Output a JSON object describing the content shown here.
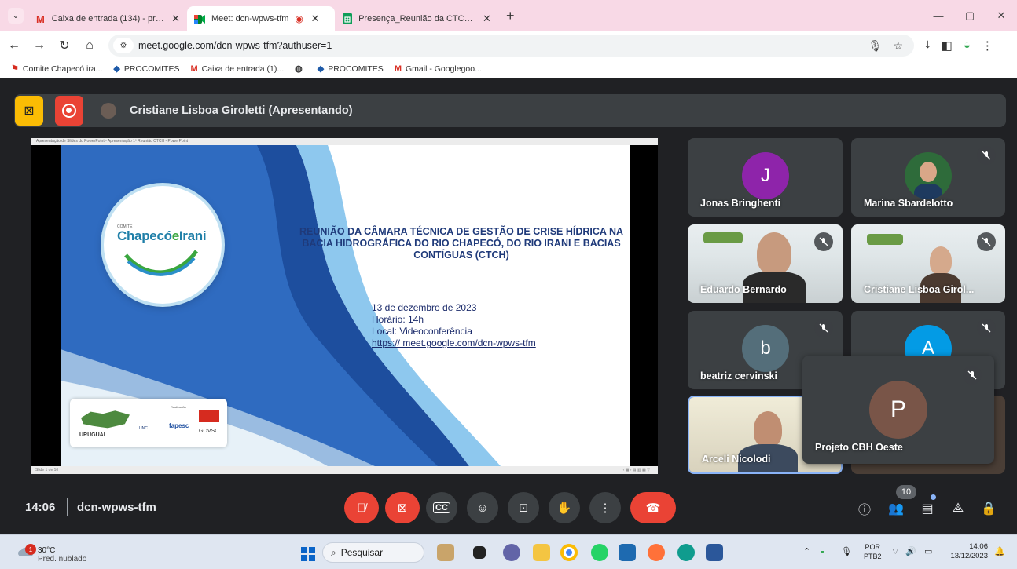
{
  "browser": {
    "tabs": [
      {
        "label": "Caixa de entrada (134) - projeto",
        "icon": "gmail-icon",
        "active": false
      },
      {
        "label": "Meet: dcn-wpws-tfm",
        "icon": "meet-icon",
        "active": true
      },
      {
        "label": "Presença_Reunião da CTCH do",
        "icon": "sheets-icon",
        "active": false
      }
    ],
    "url": "meet.google.com/dcn-wpws-tfm?authuser=1",
    "bookmarks": [
      "Comite Chapecó ira...",
      "PROCOMITES",
      "Caixa de entrada (1)...",
      "PROCOMITES",
      "Gmail - Googlegoo..."
    ]
  },
  "meet": {
    "presenter_title": "Cristiane Lisboa Giroletti (Apresentando)",
    "slide": {
      "window_title": "Apresentação de Slides do PowerPoint - Apresentação 1ª Reunião CTCH - PowerPoint",
      "meet_label": "meet.google.com/dcn-wpws-tfm",
      "logo_small": "COMITÊ",
      "logo_main_a": "Chapecó",
      "logo_main_b": "e",
      "logo_main_c": "Irani",
      "title": "REUNIÃO DA CÂMARA TÉCNICA DE GESTÃO DE CRISE HÍDRICA NA BACIA HIDROGRÁFICA DO RIO CHAPECÓ, DO RIO IRANI E BACIAS CONTÍGUAS (CTCH)",
      "date": "13 de dezembro de 2023",
      "time": "Horário: 14h",
      "place": "Local: Videoconferência",
      "link": "https:// meet.google.com/dcn-wpws-tfm",
      "footer_left": "Slide 1 de 10",
      "sponsor_uruguai": "URUGUAI",
      "sponsor_unc": "UNC",
      "sponsor_fapesc": "fapesc",
      "sponsor_gov": "GOVSC",
      "sponsor_realizacao": "Realização"
    },
    "participants": [
      {
        "name": "Jonas Bringhenti",
        "initial": "J",
        "color": "#8e24aa"
      },
      {
        "name": "Marina Sbardelotto"
      },
      {
        "name": "Eduardo Bernardo"
      },
      {
        "name": "Cristiane Lisboa Girol..."
      },
      {
        "name": "beatriz cervinski",
        "initial": "b",
        "color": "#546e7a"
      },
      {
        "name": "",
        "initial": "A",
        "color": "#039be5"
      },
      {
        "name": "Arceli Nicolodi"
      },
      {
        "name": "Projeto CBH Oeste",
        "initial": "P",
        "color": "#795548"
      }
    ],
    "clock": "14:06",
    "meeting_code": "dcn-wpws-tfm",
    "participant_count": "10"
  },
  "taskbar": {
    "temperature": "30°C",
    "weather": "Pred. nublado",
    "weather_badge": "1",
    "search_placeholder": "Pesquisar",
    "lang1": "POR",
    "lang2": "PTB2",
    "time": "14:06",
    "date": "13/12/2023"
  }
}
